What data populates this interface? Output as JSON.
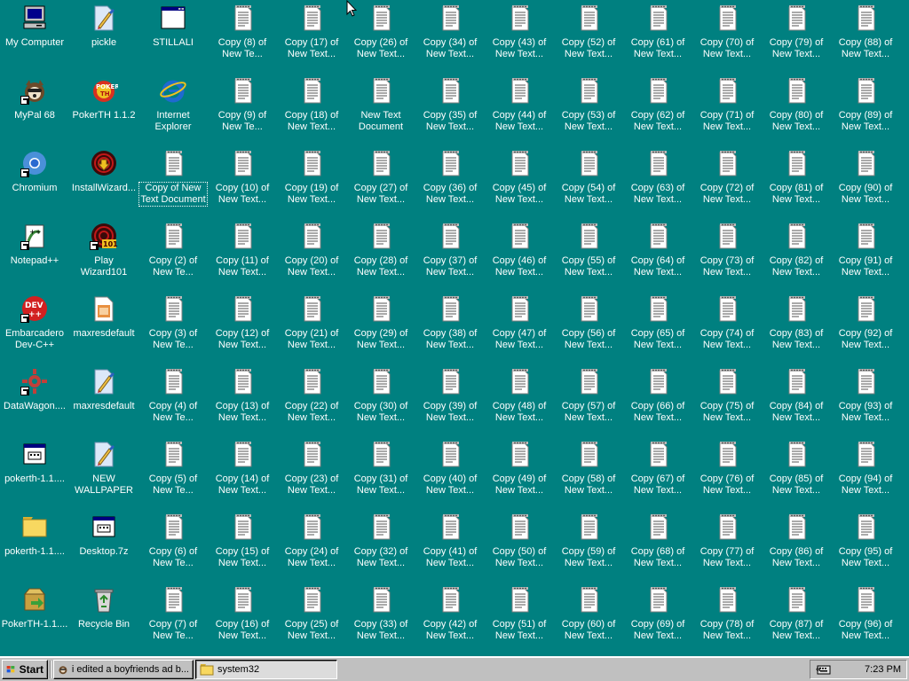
{
  "desktop": {
    "columns": [
      [
        {
          "label": "My Computer",
          "icon": "my-computer-icon",
          "shortcut": false
        },
        {
          "label": "MyPal 68",
          "icon": "mypal-icon",
          "shortcut": true
        },
        {
          "label": "Chromium",
          "icon": "chromium-icon",
          "shortcut": true
        },
        {
          "label": "Notepad++",
          "icon": "notepadpp-icon",
          "shortcut": true
        },
        {
          "label": "Embarcadero Dev-C++",
          "icon": "devcpp-icon",
          "shortcut": true
        },
        {
          "label": "DataWagon....",
          "icon": "datawagon-icon",
          "shortcut": true
        },
        {
          "label": "pokerth-1.1....",
          "icon": "exe-window-icon",
          "shortcut": false
        },
        {
          "label": "pokerth-1.1....",
          "icon": "folder-icon",
          "shortcut": false
        },
        {
          "label": "PokerTH-1.1....",
          "icon": "package-icon",
          "shortcut": false
        }
      ],
      [
        {
          "label": "pickle",
          "icon": "paint-image-icon",
          "shortcut": false
        },
        {
          "label": "PokerTH 1.1.2",
          "icon": "pokerth-icon",
          "shortcut": false
        },
        {
          "label": "InstallWizard...",
          "icon": "install-wizard-icon",
          "shortcut": false
        },
        {
          "label": "Play Wizard101",
          "icon": "wizard101-icon",
          "shortcut": true
        },
        {
          "label": "maxresdefault",
          "icon": "image-file-icon",
          "shortcut": false
        },
        {
          "label": "maxresdefault",
          "icon": "paint-image-icon",
          "shortcut": false
        },
        {
          "label": "NEW WALLPAPER",
          "icon": "paint-image-icon",
          "shortcut": false
        },
        {
          "label": "Desktop.7z",
          "icon": "exe-window-icon",
          "shortcut": false
        },
        {
          "label": "Recycle Bin",
          "icon": "recycle-bin-icon",
          "shortcut": false
        }
      ],
      [
        {
          "label": "STILLALI",
          "icon": "window-app-icon",
          "shortcut": false
        },
        {
          "label": "Internet Explorer",
          "icon": "internet-explorer-icon",
          "shortcut": false
        },
        {
          "label": "Copy of New Text Document",
          "icon": "text-document-icon",
          "shortcut": false,
          "selected": true
        },
        {
          "label": "Copy (2) of New Te...",
          "icon": "text-document-icon",
          "shortcut": false
        },
        {
          "label": "Copy (3) of New Te...",
          "icon": "text-document-icon",
          "shortcut": false
        },
        {
          "label": "Copy (4) of New Te...",
          "icon": "text-document-icon",
          "shortcut": false
        },
        {
          "label": "Copy (5) of New Te...",
          "icon": "text-document-icon",
          "shortcut": false
        },
        {
          "label": "Copy (6) of New Te...",
          "icon": "text-document-icon",
          "shortcut": false
        },
        {
          "label": "Copy (7) of New Te...",
          "icon": "text-document-icon",
          "shortcut": false
        }
      ],
      [
        {
          "label": "Copy (8) of New Te...",
          "icon": "text-document-icon"
        },
        {
          "label": "Copy (9) of New Te...",
          "icon": "text-document-icon"
        },
        {
          "label": "Copy (10) of New Text...",
          "icon": "text-document-icon"
        },
        {
          "label": "Copy (11) of New Text...",
          "icon": "text-document-icon"
        },
        {
          "label": "Copy (12) of New Text...",
          "icon": "text-document-icon"
        },
        {
          "label": "Copy (13) of New Text...",
          "icon": "text-document-icon"
        },
        {
          "label": "Copy (14) of New Text...",
          "icon": "text-document-icon"
        },
        {
          "label": "Copy (15) of New Text...",
          "icon": "text-document-icon"
        },
        {
          "label": "Copy (16) of New Text...",
          "icon": "text-document-icon"
        }
      ],
      [
        {
          "label": "Copy (17) of New Text...",
          "icon": "text-document-icon"
        },
        {
          "label": "Copy (18) of New Text...",
          "icon": "text-document-icon"
        },
        {
          "label": "Copy (19) of New Text...",
          "icon": "text-document-icon"
        },
        {
          "label": "Copy (20) of New Text...",
          "icon": "text-document-icon"
        },
        {
          "label": "Copy (21) of New Text...",
          "icon": "text-document-icon"
        },
        {
          "label": "Copy (22) of New Text...",
          "icon": "text-document-icon"
        },
        {
          "label": "Copy (23) of New Text...",
          "icon": "text-document-icon"
        },
        {
          "label": "Copy (24) of New Text...",
          "icon": "text-document-icon"
        },
        {
          "label": "Copy (25) of New Text...",
          "icon": "text-document-icon"
        }
      ],
      [
        {
          "label": "Copy (26) of New Text...",
          "icon": "text-document-icon"
        },
        {
          "label": "New Text Document",
          "icon": "text-document-icon"
        },
        {
          "label": "Copy (27) of New Text...",
          "icon": "text-document-icon"
        },
        {
          "label": "Copy (28) of New Text...",
          "icon": "text-document-icon"
        },
        {
          "label": "Copy (29) of New Text...",
          "icon": "text-document-icon"
        },
        {
          "label": "Copy (30) of New Text...",
          "icon": "text-document-icon"
        },
        {
          "label": "Copy (31) of New Text...",
          "icon": "text-document-icon"
        },
        {
          "label": "Copy (32) of New Text...",
          "icon": "text-document-icon"
        },
        {
          "label": "Copy (33) of New Text...",
          "icon": "text-document-icon"
        }
      ],
      [
        {
          "label": "Copy (34) of New Text...",
          "icon": "text-document-icon"
        },
        {
          "label": "Copy (35) of New Text...",
          "icon": "text-document-icon"
        },
        {
          "label": "Copy (36) of New Text...",
          "icon": "text-document-icon"
        },
        {
          "label": "Copy (37) of New Text...",
          "icon": "text-document-icon"
        },
        {
          "label": "Copy (38) of New Text...",
          "icon": "text-document-icon"
        },
        {
          "label": "Copy (39) of New Text...",
          "icon": "text-document-icon"
        },
        {
          "label": "Copy (40) of New Text...",
          "icon": "text-document-icon"
        },
        {
          "label": "Copy (41) of New Text...",
          "icon": "text-document-icon"
        },
        {
          "label": "Copy (42) of New Text...",
          "icon": "text-document-icon"
        }
      ],
      [
        {
          "label": "Copy (43) of New Text...",
          "icon": "text-document-icon"
        },
        {
          "label": "Copy (44) of New Text...",
          "icon": "text-document-icon"
        },
        {
          "label": "Copy (45) of New Text...",
          "icon": "text-document-icon"
        },
        {
          "label": "Copy (46) of New Text...",
          "icon": "text-document-icon"
        },
        {
          "label": "Copy (47) of New Text...",
          "icon": "text-document-icon"
        },
        {
          "label": "Copy (48) of New Text...",
          "icon": "text-document-icon"
        },
        {
          "label": "Copy (49) of New Text...",
          "icon": "text-document-icon"
        },
        {
          "label": "Copy (50) of New Text...",
          "icon": "text-document-icon"
        },
        {
          "label": "Copy (51) of New Text...",
          "icon": "text-document-icon"
        }
      ],
      [
        {
          "label": "Copy (52) of New Text...",
          "icon": "text-document-icon"
        },
        {
          "label": "Copy (53) of New Text...",
          "icon": "text-document-icon"
        },
        {
          "label": "Copy (54) of New Text...",
          "icon": "text-document-icon"
        },
        {
          "label": "Copy (55) of New Text...",
          "icon": "text-document-icon"
        },
        {
          "label": "Copy (56) of New Text...",
          "icon": "text-document-icon"
        },
        {
          "label": "Copy (57) of New Text...",
          "icon": "text-document-icon"
        },
        {
          "label": "Copy (58) of New Text...",
          "icon": "text-document-icon"
        },
        {
          "label": "Copy (59) of New Text...",
          "icon": "text-document-icon"
        },
        {
          "label": "Copy (60) of New Text...",
          "icon": "text-document-icon"
        }
      ],
      [
        {
          "label": "Copy (61) of New Text...",
          "icon": "text-document-icon"
        },
        {
          "label": "Copy (62) of New Text...",
          "icon": "text-document-icon"
        },
        {
          "label": "Copy (63) of New Text...",
          "icon": "text-document-icon"
        },
        {
          "label": "Copy (64) of New Text...",
          "icon": "text-document-icon"
        },
        {
          "label": "Copy (65) of New Text...",
          "icon": "text-document-icon"
        },
        {
          "label": "Copy (66) of New Text...",
          "icon": "text-document-icon"
        },
        {
          "label": "Copy (67) of New Text...",
          "icon": "text-document-icon"
        },
        {
          "label": "Copy (68) of New Text...",
          "icon": "text-document-icon"
        },
        {
          "label": "Copy (69) of New Text...",
          "icon": "text-document-icon"
        }
      ],
      [
        {
          "label": "Copy (70) of New Text...",
          "icon": "text-document-icon"
        },
        {
          "label": "Copy (71) of New Text...",
          "icon": "text-document-icon"
        },
        {
          "label": "Copy (72) of New Text...",
          "icon": "text-document-icon"
        },
        {
          "label": "Copy (73) of New Text...",
          "icon": "text-document-icon"
        },
        {
          "label": "Copy (74) of New Text...",
          "icon": "text-document-icon"
        },
        {
          "label": "Copy (75) of New Text...",
          "icon": "text-document-icon"
        },
        {
          "label": "Copy (76) of New Text...",
          "icon": "text-document-icon"
        },
        {
          "label": "Copy (77) of New Text...",
          "icon": "text-document-icon"
        },
        {
          "label": "Copy (78) of New Text...",
          "icon": "text-document-icon"
        }
      ],
      [
        {
          "label": "Copy (79) of New Text...",
          "icon": "text-document-icon"
        },
        {
          "label": "Copy (80) of New Text...",
          "icon": "text-document-icon"
        },
        {
          "label": "Copy (81) of New Text...",
          "icon": "text-document-icon"
        },
        {
          "label": "Copy (82) of New Text...",
          "icon": "text-document-icon"
        },
        {
          "label": "Copy (83) of New Text...",
          "icon": "text-document-icon"
        },
        {
          "label": "Copy (84) of New Text...",
          "icon": "text-document-icon"
        },
        {
          "label": "Copy (85) of New Text...",
          "icon": "text-document-icon"
        },
        {
          "label": "Copy (86) of New Text...",
          "icon": "text-document-icon"
        },
        {
          "label": "Copy (87) of New Text...",
          "icon": "text-document-icon"
        }
      ],
      [
        {
          "label": "Copy (88) of New Text...",
          "icon": "text-document-icon"
        },
        {
          "label": "Copy (89) of New Text...",
          "icon": "text-document-icon"
        },
        {
          "label": "Copy (90) of New Text...",
          "icon": "text-document-icon"
        },
        {
          "label": "Copy (91) of New Text...",
          "icon": "text-document-icon"
        },
        {
          "label": "Copy (92) of New Text...",
          "icon": "text-document-icon"
        },
        {
          "label": "Copy (93) of New Text...",
          "icon": "text-document-icon"
        },
        {
          "label": "Copy (94) of New Text...",
          "icon": "text-document-icon"
        },
        {
          "label": "Copy (95) of New Text...",
          "icon": "text-document-icon"
        },
        {
          "label": "Copy (96) of New Text...",
          "icon": "text-document-icon"
        }
      ]
    ]
  },
  "taskbar": {
    "start_label": "Start",
    "tasks": [
      {
        "label": "i edited a boyfriends ad b...",
        "icon": "mypal-icon",
        "pressed": false
      },
      {
        "label": "system32",
        "icon": "folder-icon",
        "pressed": true
      }
    ],
    "tray": {
      "back_label": "«",
      "clock": "7:23 PM",
      "tray_icon": "keyboard-icon"
    }
  },
  "colors": {
    "desktop_background": "#008080",
    "taskbar": "#c0c0c0"
  }
}
